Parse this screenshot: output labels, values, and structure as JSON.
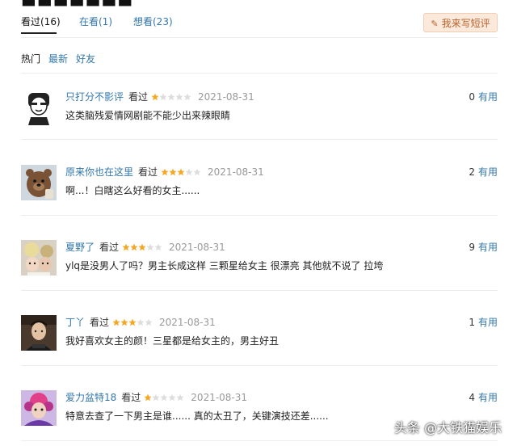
{
  "tabs": [
    {
      "label": "看过(16)"
    },
    {
      "label": "在看(1)"
    },
    {
      "label": "想看(23)"
    }
  ],
  "write_button": {
    "label": "我来写短评",
    "icon": "pencil-icon"
  },
  "sort_options": [
    {
      "label": "热门"
    },
    {
      "label": "最新"
    },
    {
      "label": "好友"
    }
  ],
  "star_color": "#f5a623",
  "useful_label": "有用",
  "reviews": [
    {
      "user": "只打分不影评",
      "status": "看过",
      "rating": 1,
      "date": "2021-08-31",
      "comment": "这类脑残爱情网剧能不能少出来辣眼睛",
      "useful": "0"
    },
    {
      "user": "原来你也在这里",
      "status": "看过",
      "rating": 3,
      "date": "2021-08-31",
      "comment": "啊...！白瞎这么好看的女主......",
      "useful": "2"
    },
    {
      "user": "夏野了",
      "status": "看过",
      "rating": 3,
      "date": "2021-08-31",
      "comment": "ylq是没男人了吗？男主长成这样 三颗星给女主 很漂亮 其他就不说了 拉垮",
      "useful": "9"
    },
    {
      "user": "丁丫",
      "status": "看过",
      "rating": 3,
      "date": "2021-08-31",
      "comment": "我好喜欢女主的颜！三星都是给女主的，男主好丑",
      "useful": "1"
    },
    {
      "user": "爱力盆特18",
      "status": "看过",
      "rating": 1,
      "date": "2021-08-31",
      "comment": "特意去查了一下男主是谁...... 真的太丑了，关键演技还差......",
      "useful": "4"
    }
  ],
  "watermark": "头条 @大铁猫娱乐"
}
